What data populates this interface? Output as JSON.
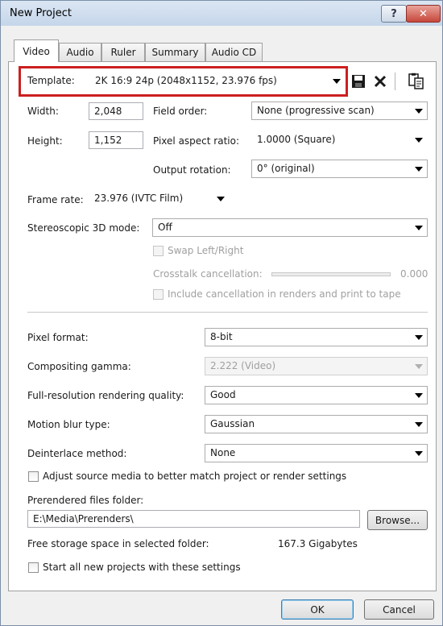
{
  "window": {
    "title": "New Project",
    "help_glyph": "?",
    "close_glyph": "✕"
  },
  "tabs": [
    {
      "label": "Video",
      "active": true
    },
    {
      "label": "Audio"
    },
    {
      "label": "Ruler"
    },
    {
      "label": "Summary"
    },
    {
      "label": "Audio CD"
    }
  ],
  "template": {
    "label": "Template:",
    "value": "2K 16:9 24p (2048x1152, 23.976 fps)"
  },
  "width": {
    "label": "Width:",
    "value": "2,048"
  },
  "height": {
    "label": "Height:",
    "value": "1,152"
  },
  "field_order": {
    "label": "Field order:",
    "value": "None (progressive scan)"
  },
  "pixel_aspect": {
    "label": "Pixel aspect ratio:",
    "value": "1.0000 (Square)"
  },
  "output_rotation": {
    "label": "Output rotation:",
    "value": "0° (original)"
  },
  "frame_rate": {
    "label": "Frame rate:",
    "value": "23.976 (IVTC Film)"
  },
  "stereo3d": {
    "label": "Stereoscopic 3D mode:",
    "value": "Off"
  },
  "swap_lr": {
    "label": "Swap Left/Right",
    "checked": false,
    "enabled": false
  },
  "crosstalk": {
    "label": "Crosstalk cancellation:",
    "value": "0.000",
    "enabled": false
  },
  "include_cancel": {
    "label": "Include cancellation in renders and print to tape",
    "checked": false,
    "enabled": false
  },
  "pixel_format": {
    "label": "Pixel format:",
    "value": "8-bit"
  },
  "compositing_gamma": {
    "label": "Compositing gamma:",
    "value": "2.222 (Video)",
    "enabled": false
  },
  "render_quality": {
    "label": "Full-resolution rendering quality:",
    "value": "Good"
  },
  "motion_blur": {
    "label": "Motion blur type:",
    "value": "Gaussian"
  },
  "deinterlace": {
    "label": "Deinterlace method:",
    "value": "None"
  },
  "adjust_source": {
    "label": "Adjust source media to better match project or render settings",
    "checked": false
  },
  "prerender": {
    "label": "Prerendered files folder:",
    "value": "E:\\Media\\Prerenders\\",
    "browse_label": "Browse..."
  },
  "storage": {
    "label": "Free storage space in selected folder:",
    "value": "167.3 Gigabytes"
  },
  "start_new": {
    "label": "Start all new projects with these settings",
    "checked": false
  },
  "footer": {
    "ok_label": "OK",
    "cancel_label": "Cancel"
  },
  "icons": {
    "save": "save-icon",
    "delete": "delete-icon",
    "copy": "copy-icon"
  },
  "colors": {
    "highlight": "#cc1f1f",
    "close_button": "#c6473a",
    "accent": "#3c7fb1"
  }
}
